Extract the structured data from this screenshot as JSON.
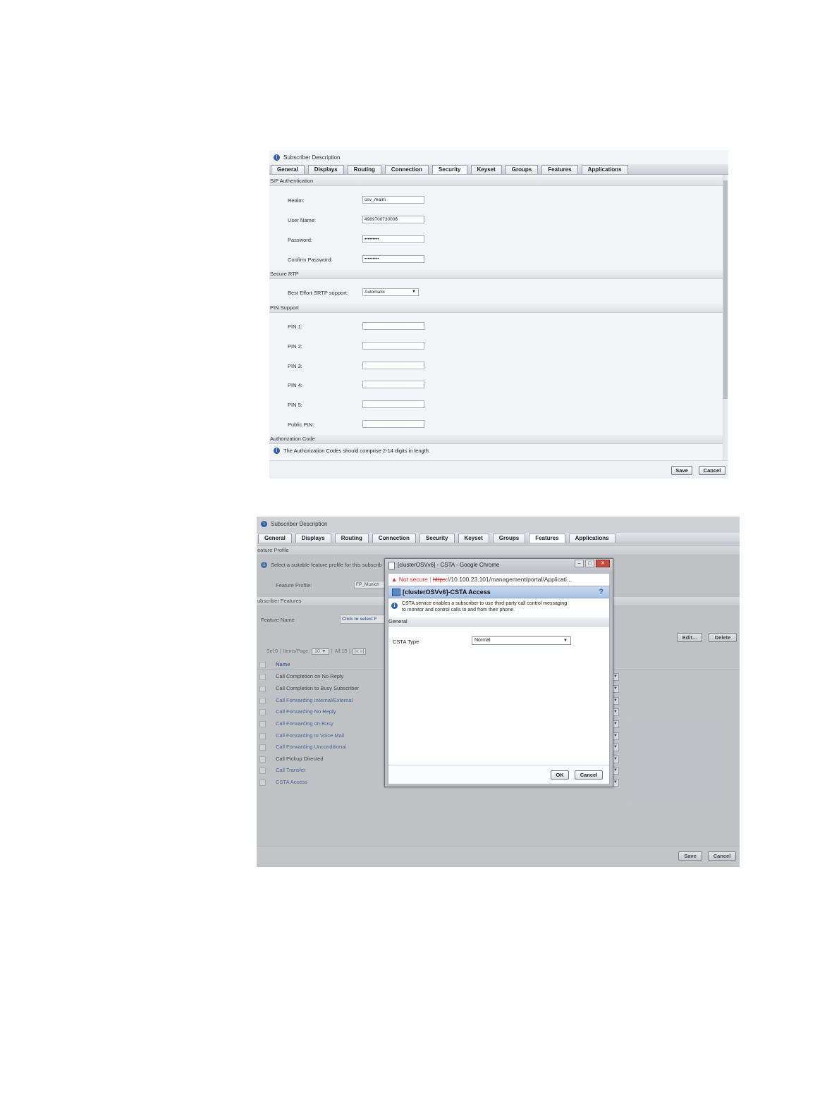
{
  "screen1": {
    "description_label": "Subscriber Description",
    "tabs": [
      "General",
      "Displays",
      "Routing",
      "Connection",
      "Security",
      "Keyset",
      "Groups",
      "Features",
      "Applications"
    ],
    "active_tab": "Security",
    "sections": {
      "sip_auth": "SIP Authentication",
      "secure_rtp": "Secure RTP",
      "pin_support": "PIN Support",
      "auth_code": "Authorization Code"
    },
    "fields": {
      "realm": {
        "label": "Realm:",
        "value": "osv_realm"
      },
      "username": {
        "label": "User Name:",
        "value": "4989700730006"
      },
      "password": {
        "label": "Password:",
        "value": "•••••••••"
      },
      "confirm_password": {
        "label": "Confirm Password:",
        "value": "•••••••••"
      },
      "srtp": {
        "label": "Best Effort SRTP support:",
        "value": "Automatic"
      },
      "pin1": {
        "label": "PIN 1:",
        "value": ""
      },
      "pin2": {
        "label": "PIN 2:",
        "value": ""
      },
      "pin3": {
        "label": "PIN 3:",
        "value": ""
      },
      "pin4": {
        "label": "PIN 4:",
        "value": ""
      },
      "pin5": {
        "label": "PIN 5:",
        "value": ""
      },
      "public_pin": {
        "label": "Public PIN:",
        "value": ""
      }
    },
    "auth_info": "The Authorization Codes should comprise 2-14 digits in length.",
    "buttons": {
      "save": "Save",
      "cancel": "Cancel"
    }
  },
  "screen2": {
    "description_label": "Subscriber Description",
    "tabs": [
      "General",
      "Displays",
      "Routing",
      "Connection",
      "Security",
      "Keyset",
      "Groups",
      "Features",
      "Applications"
    ],
    "active_tab": "Features",
    "feature_profile_section": "eature Profile",
    "feature_profile_info": "Select a suitable feature profile for this subscrib",
    "feature_profile_label": "Feature Profile:",
    "feature_profile_value": "FP_Munich",
    "subscriber_features_section": "ubscriber Features",
    "feature_name_label": "Feature Name",
    "feature_name_input": "Click to select F",
    "edit_label": "Edit...",
    "delete_label": "Delete",
    "pager": {
      "sel": "Sel:0",
      "items_per_page": "Items/Page:",
      "per_page_value": "10",
      "all": "All:18"
    },
    "name_header": "Name",
    "features": [
      "Call Completion on No Reply",
      "Call Completion to Busy Subscriber",
      "Call Forwarding Internal/External",
      "Call Forwarding No Reply",
      "Call Forwarding on Busy",
      "Call Forwarding to Voice Mail",
      "Call Forwarding Unconditional",
      "Call Pickup Directed",
      "Call Transfer",
      "CSTA Access"
    ],
    "buttons": {
      "save": "Save",
      "cancel": "Cancel"
    }
  },
  "popup": {
    "window_title": "[clusterOSVv6] - CSTA - Google Chrome",
    "not_secure": "Not secure",
    "url_scheme": "https",
    "url_rest": "://10.100.23.101/management/portal/Applicati...",
    "dialog_title": "[clusterOSVv6]-CSTA Access",
    "help": "?",
    "info_line1": "CSTA service enables a subscriber to use third-party call control messaging",
    "info_line2": "to monitor and control calls to and from their phone.",
    "general_section": "General",
    "csta_type_label": "CSTA Type",
    "csta_type_value": "Normal",
    "ok": "OK",
    "cancel": "Cancel",
    "colors": {
      "address_bar_warning": "#d93025",
      "dialog_header": "#b3cbea",
      "link_blue": "#2b4f95"
    }
  }
}
